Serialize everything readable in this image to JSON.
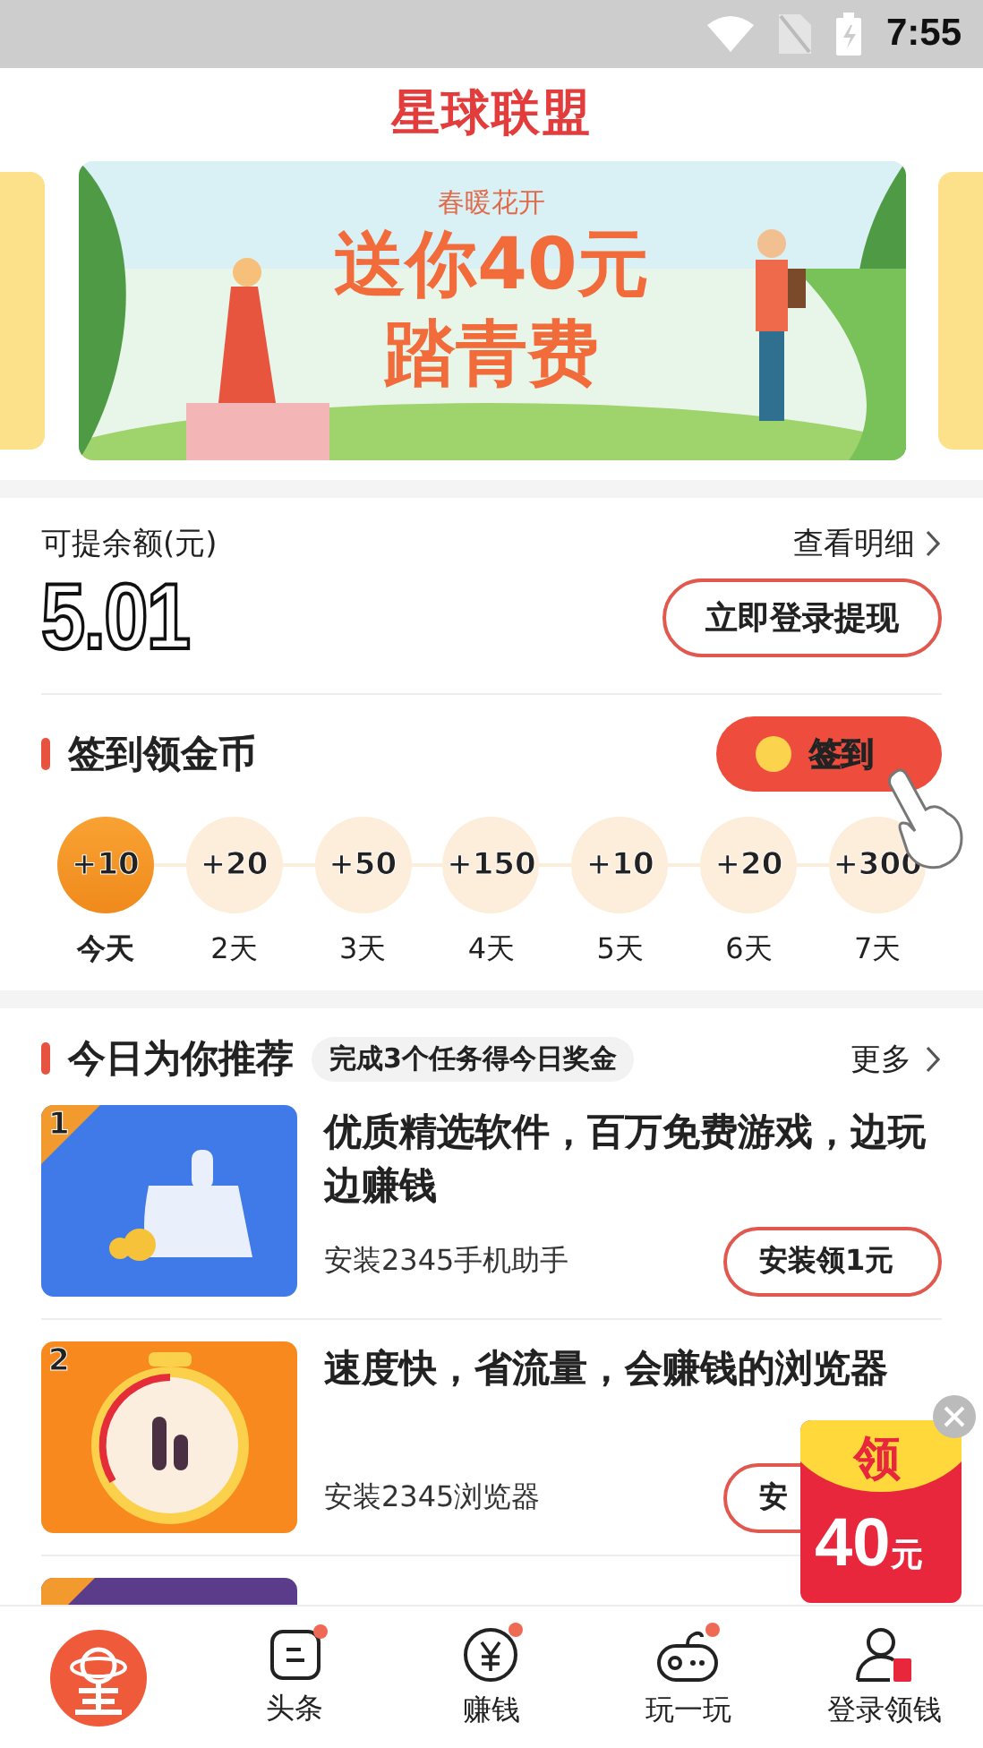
{
  "status_bar": {
    "time": "7:55"
  },
  "header": {
    "logo_text": "星球联盟"
  },
  "banner": {
    "subtitle": "春暖花开",
    "headline": "送你40元",
    "headline_2": "踏青费"
  },
  "balance": {
    "label": "可提余额(元)",
    "details_link": "查看明细",
    "amount": "5.01",
    "withdraw_button": "立即登录提现"
  },
  "checkin": {
    "title": "签到领金币",
    "button": "签到",
    "days": [
      {
        "reward": "+10",
        "label": "今天",
        "current": true
      },
      {
        "reward": "+20",
        "label": "2天",
        "current": false
      },
      {
        "reward": "+50",
        "label": "3天",
        "current": false
      },
      {
        "reward": "+150",
        "label": "4天",
        "current": false
      },
      {
        "reward": "+10",
        "label": "5天",
        "current": false
      },
      {
        "reward": "+20",
        "label": "6天",
        "current": false
      },
      {
        "reward": "+300",
        "label": "7天",
        "current": false
      }
    ]
  },
  "recommend": {
    "title": "今日为你推荐",
    "tag": "完成3个任务得今日奖金",
    "more_link": "更多",
    "items": [
      {
        "rank": "1",
        "kind": "broom",
        "title": "优质精选软件，百万免费游戏，边玩边赚钱",
        "subtitle": "安装2345手机助手",
        "button": "安装领1元"
      },
      {
        "rank": "2",
        "kind": "timer",
        "title": "速度快，省流量，会赚钱的浏览器",
        "subtitle": "安装2345浏览器",
        "button": "安"
      },
      {
        "kind": "picture"
      }
    ]
  },
  "floating_offer": {
    "label": "领",
    "amount": "40",
    "unit": "元"
  },
  "bottom_nav": [
    {
      "kind": "logo",
      "dot": false
    },
    {
      "kind": "news",
      "label": "头条",
      "dot": true
    },
    {
      "kind": "money",
      "label": "赚钱",
      "dot": true
    },
    {
      "kind": "game",
      "label": "玩一玩",
      "dot": true
    },
    {
      "kind": "user",
      "label": "登录领钱",
      "dot": false
    }
  ]
}
